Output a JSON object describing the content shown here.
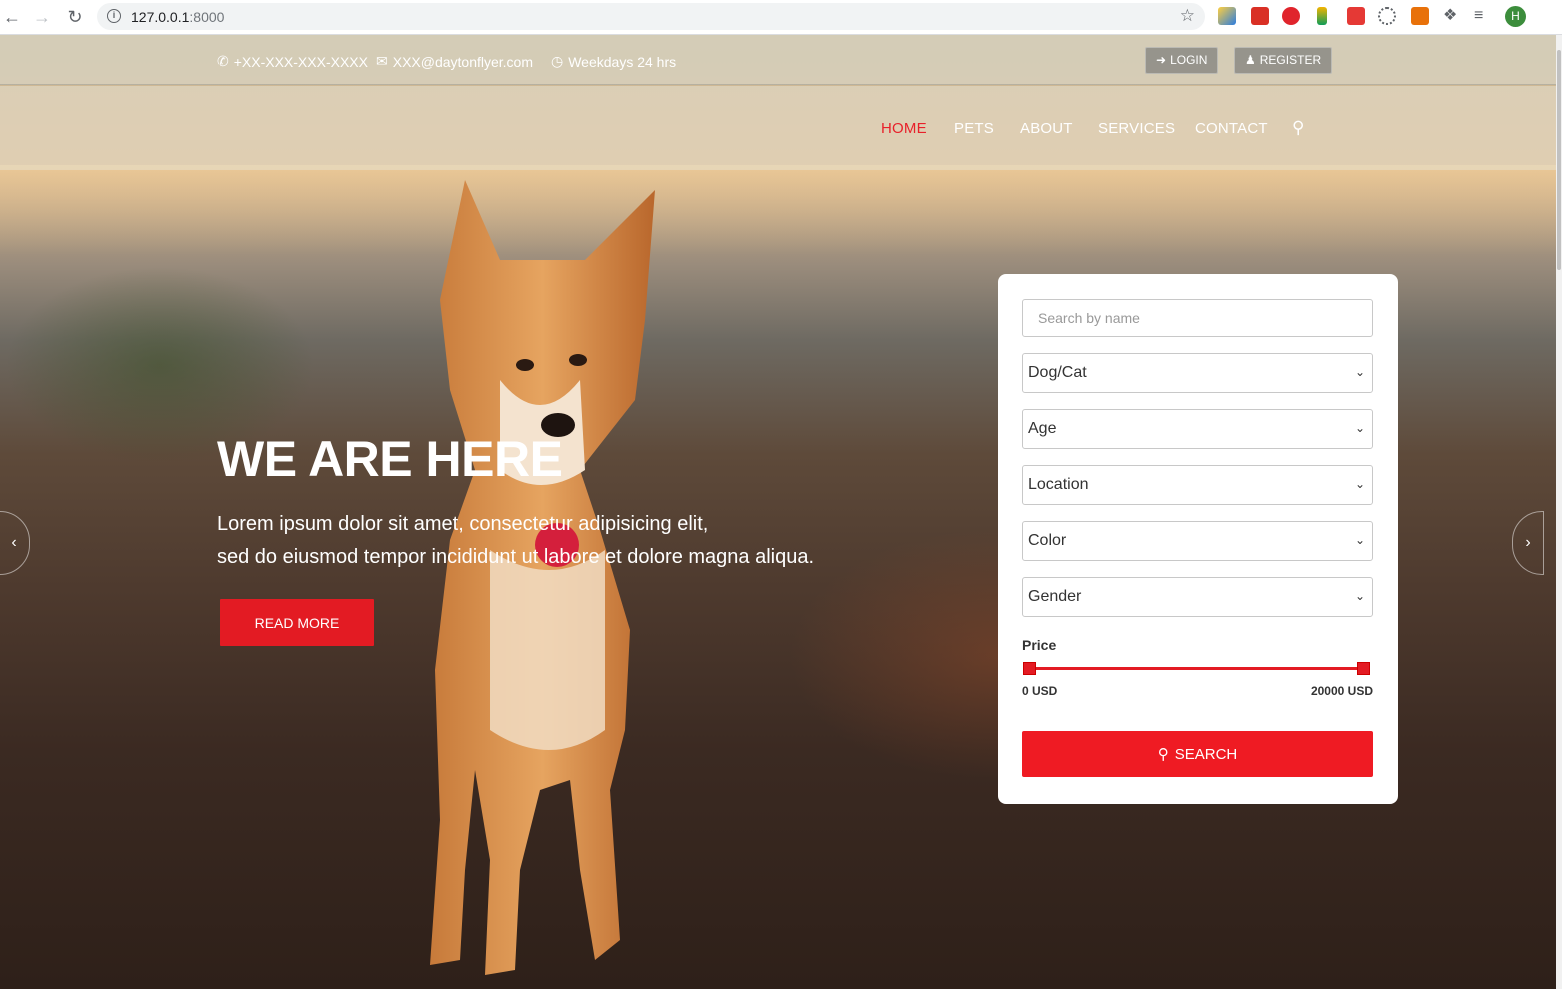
{
  "browser": {
    "url_host": "127.0.0.1",
    "url_port": ":8000",
    "profile_initial": "H"
  },
  "topbar": {
    "phone": "+XX-XXX-XXX-XXXX",
    "email": "XXX@daytonflyer.com",
    "hours": "Weekdays 24 hrs",
    "login_label": "LOGIN",
    "register_label": "REGISTER"
  },
  "nav": {
    "items": [
      {
        "label": "HOME",
        "active": true
      },
      {
        "label": "PETS",
        "active": false
      },
      {
        "label": "ABOUT",
        "active": false
      },
      {
        "label": "SERVICES",
        "active": false
      },
      {
        "label": "CONTACT",
        "active": false
      }
    ]
  },
  "hero": {
    "title": "WE ARE HERE",
    "line1": "Lorem ipsum dolor sit amet, consectetur adipisicing elit,",
    "line2": "sed do eiusmod tempor incididunt ut labore et dolore magna aliqua.",
    "cta_label": "READ MORE"
  },
  "search": {
    "name_placeholder": "Search by name",
    "selects": [
      "Dog/Cat",
      "Age",
      "Location",
      "Color",
      "Gender"
    ],
    "price_label": "Price",
    "price_min": "0 USD",
    "price_max": "20000 USD",
    "button_label": "SEARCH"
  },
  "colors": {
    "accent": "#e31b23"
  }
}
